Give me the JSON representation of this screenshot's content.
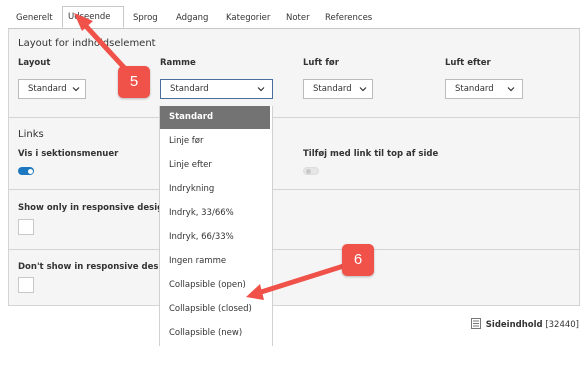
{
  "tabs": [
    "Generelt",
    "Udseende",
    "Sprog",
    "Adgang",
    "Kategorier",
    "Noter",
    "References"
  ],
  "layout_section": {
    "title": "Layout for indholdselement",
    "fields": [
      {
        "label": "Layout",
        "value": "Standard"
      },
      {
        "label": "Ramme",
        "value": "Standard"
      },
      {
        "label": "Luft før",
        "value": "Standard"
      },
      {
        "label": "Luft efter",
        "value": "Standard"
      }
    ]
  },
  "ramme_dropdown": {
    "options": [
      "Standard",
      "Linje før",
      "Linje efter",
      "Indrykning",
      "Indryk, 33/66%",
      "Indryk, 66/33%",
      "Ingen ramme",
      "Collapsible (open)",
      "Collapsible (closed)",
      "Collapsible (new)"
    ],
    "selected": "Standard"
  },
  "links_section": {
    "title": "Links",
    "vis_label": "Vis i sektionsmenuer",
    "vis_on": true,
    "tilfoj_label": "Tilføj med link til top af side",
    "tilfoj_on": false
  },
  "responsive": {
    "show_only_label": "Show only in responsive design",
    "dont_show_label": "Don't show in responsive design"
  },
  "footer": {
    "label": "Sideindhold",
    "id": "[32440]"
  },
  "annotations": {
    "badge_5": "5",
    "badge_6": "6",
    "color": "#f0524a"
  }
}
